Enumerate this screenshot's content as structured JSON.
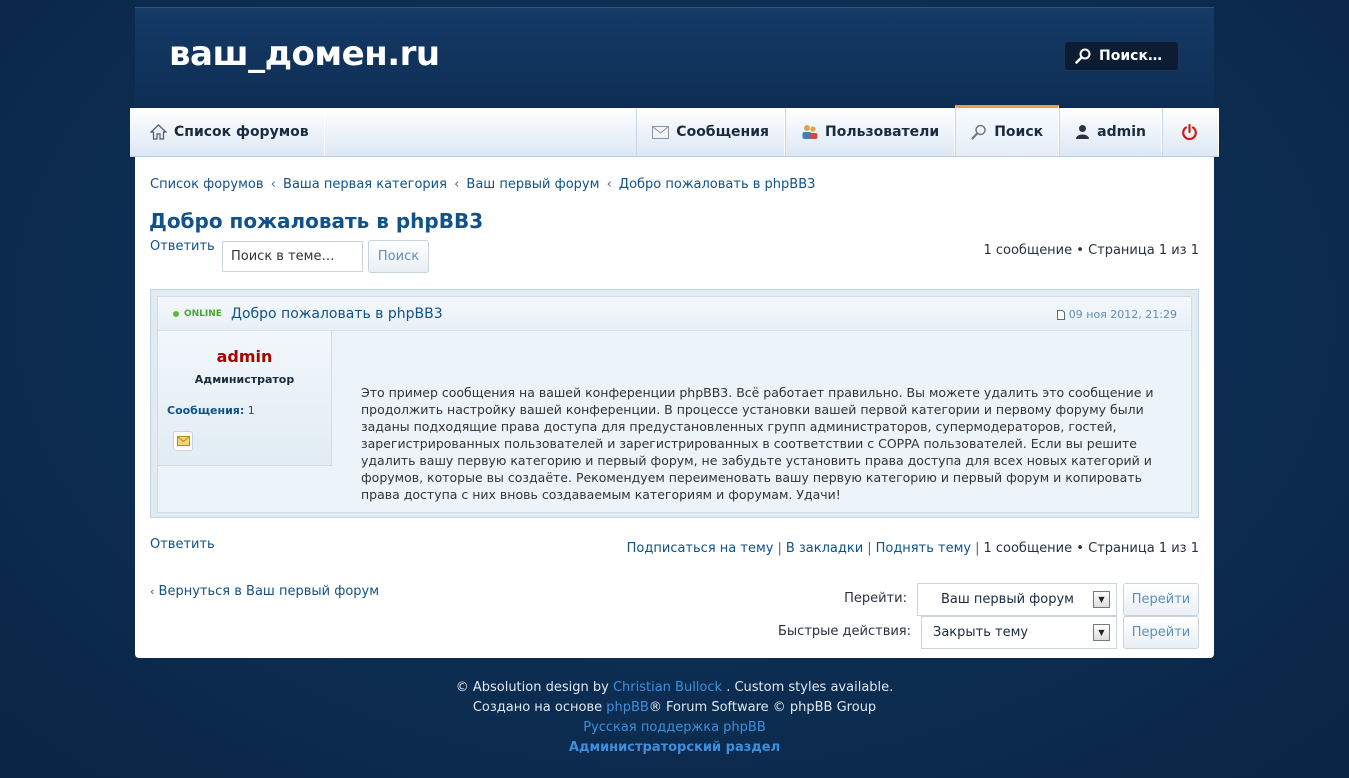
{
  "header": {
    "logo": "ваш_домен.ru",
    "search_label": "Поиск…"
  },
  "nav": {
    "forums": "Список форумов",
    "messages": "Сообщения",
    "users": "Пользователи",
    "search": "Поиск",
    "user": "admin"
  },
  "breadcrumb": {
    "items": [
      "Список форумов",
      "Ваша первая категория",
      "Ваш первый форум",
      "Добро пожаловать в phpBB3"
    ],
    "separator": "‹"
  },
  "topic": {
    "title": "Добро пожаловать в phpBB3",
    "reply_label": "Ответить",
    "search_placeholder": "Поиск в теме…",
    "search_button": "Поиск",
    "pagination": "1 сообщение • Страница 1 из 1"
  },
  "post": {
    "online": "ONLINE",
    "title": "Добро пожаловать в phpBB3",
    "date": "09 ноя 2012, 21:29",
    "author": "admin",
    "rank": "Администратор",
    "posts_label": "Сообщения:",
    "posts_count": "1",
    "body": "Это пример сообщения на вашей конференции phpBB3. Всё работает правильно. Вы можете удалить это сообщение и продолжить настройку вашей конференции. В процессе установки вашей первой категории и первому форуму были заданы подходящие права доступа для предустановленных групп администраторов, супермодераторов, гостей, зарегистрированных пользователей и зарегистрированных в соответствии с COPPA пользователей. Если вы решите удалить вашу первую категорию и первый форум, не забудьте установить права доступа для всех новых категорий и форумов, которые вы создаёте. Рекомендуем переименовать вашу первую категорию и первый форум и копировать права доступа с них вновь создаваемым категориям и форумам. Удачи!"
  },
  "bottom": {
    "reply_label": "Ответить",
    "subscribe": "Подписаться на тему",
    "bookmark": "В закладки",
    "bump": "Поднять тему",
    "pagination": "1 сообщение • Страница 1 из 1",
    "back": "Вернуться в Ваш первый форум",
    "jump_label": "Перейти:",
    "jump_value": "Ваш первый форум",
    "jump_button": "Перейти",
    "quick_label": "Быстрые действия:",
    "quick_value": "Закрыть тему",
    "quick_button": "Перейти"
  },
  "footer": {
    "line1_pre": "© Absolution design by",
    "line1_link": "Christian Bullock",
    "line1_post": ". Custom styles available.",
    "line2_pre": "Создано на основе",
    "line2_link": "phpBB",
    "line2_post": "® Forum Software © phpBB Group",
    "line3": "Русская поддержка phpBB",
    "line4": "Администраторский раздел"
  },
  "colors": {
    "accent": "#105289",
    "author": "#aa0000",
    "online": "#4aa52b",
    "nav_active": "#e8a23b"
  }
}
